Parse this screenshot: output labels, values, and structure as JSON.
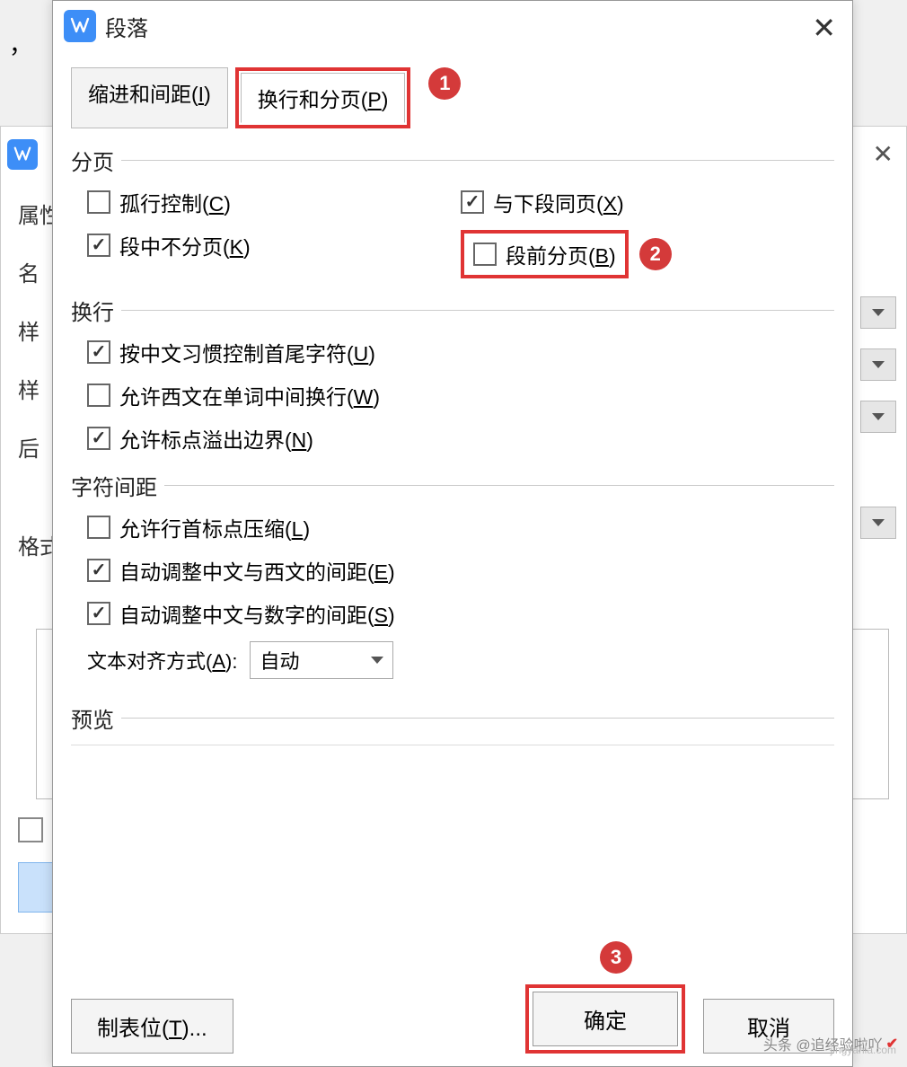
{
  "bg": {
    "comma": "，",
    "labels": {
      "attr": "属性",
      "name": "名",
      "st1": "样",
      "st2": "样",
      "after": "后",
      "format": "格式"
    },
    "close": "✕"
  },
  "dialog": {
    "title": "段落",
    "close": "✕"
  },
  "tabs": {
    "indent": {
      "pre": "缩进和间距(",
      "key": "I",
      "post": ")"
    },
    "page": {
      "pre": "换行和分页(",
      "key": "P",
      "post": ")"
    }
  },
  "badges": {
    "one": "1",
    "two": "2",
    "three": "3"
  },
  "sections": {
    "paging": "分页",
    "line": "换行",
    "spacing": "字符间距",
    "preview": "预览"
  },
  "checks": {
    "orphan": {
      "pre": "孤行控制(",
      "key": "C",
      "post": ")",
      "checked": false
    },
    "keepnext": {
      "pre": "与下段同页(",
      "key": "X",
      "post": ")",
      "checked": true
    },
    "keeptog": {
      "pre": "段中不分页(",
      "key": "K",
      "post": ")",
      "checked": true
    },
    "pagebrk": {
      "pre": "段前分页(",
      "key": "B",
      "post": ")",
      "checked": false
    },
    "cjk": {
      "pre": "按中文习惯控制首尾字符(",
      "key": "U",
      "post": ")",
      "checked": true
    },
    "latin": {
      "pre": "允许西文在单词中间换行(",
      "key": "W",
      "post": ")",
      "checked": false
    },
    "punct": {
      "pre": "允许标点溢出边界(",
      "key": "N",
      "post": ")",
      "checked": true
    },
    "compress": {
      "pre": "允许行首标点压缩(",
      "key": "L",
      "post": ")",
      "checked": false
    },
    "cjklat": {
      "pre": "自动调整中文与西文的间距(",
      "key": "E",
      "post": ")",
      "checked": true
    },
    "cjknum": {
      "pre": "自动调整中文与数字的间距(",
      "key": "S",
      "post": ")",
      "checked": true
    }
  },
  "align": {
    "label": {
      "pre": "文本对齐方式(",
      "key": "A",
      "post": "):"
    },
    "value": "自动"
  },
  "buttons": {
    "tabs": {
      "pre": "制表位(",
      "key": "T",
      "post": ")..."
    },
    "ok": "确定",
    "cancel": "取消"
  },
  "watermark": {
    "t1": "头条 @追经验啦吖",
    "t2": "jingyanla.com"
  }
}
